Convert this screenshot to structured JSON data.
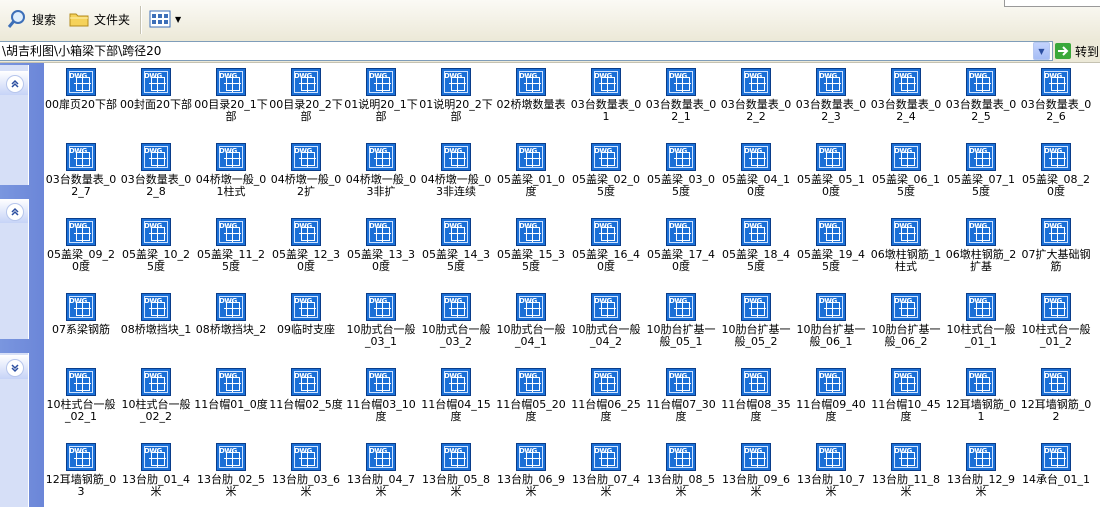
{
  "toolbar": {
    "search_label": "搜索",
    "folders_label": "文件夹",
    "view_label": ""
  },
  "address": {
    "path": "\\胡吉利图\\小箱梁下部\\跨径20",
    "go_label": "转到"
  },
  "files": [
    [
      "00扉页20下部",
      "00封面20下部",
      "00目录20_1下部",
      "00目录20_2下部",
      "01说明20_1下部",
      "01说明20_2下部",
      "02桥墩数量表",
      "03台数量表_01",
      "03台数量表_02_1",
      "03台数量表_02_2",
      "03台数量表_02_3",
      "03台数量表_02_4",
      "03台数量表_02_5",
      "03台数量表_02_6"
    ],
    [
      "03台数量表_02_7",
      "03台数量表_02_8",
      "04桥墩一般_01柱式",
      "04桥墩一般_02扩",
      "04桥墩一般_03非扩",
      "04桥墩一般_03非连续",
      "05盖梁_01_0度",
      "05盖梁_02_05度",
      "05盖梁_03_05度",
      "05盖梁_04_10度",
      "05盖梁_05_10度",
      "05盖梁_06_15度",
      "05盖梁_07_15度",
      "05盖梁_08_20度"
    ],
    [
      "05盖梁_09_20度",
      "05盖梁_10_25度",
      "05盖梁_11_25度",
      "05盖梁_12_30度",
      "05盖梁_13_30度",
      "05盖梁_14_35度",
      "05盖梁_15_35度",
      "05盖梁_16_40度",
      "05盖梁_17_40度",
      "05盖梁_18_45度",
      "05盖梁_19_45度",
      "06墩柱钢筋_1柱式",
      "06墩柱钢筋_2扩基",
      "07扩大基础钢筋"
    ],
    [
      "07系梁钢筋",
      "08桥墩挡块_1",
      "08桥墩挡块_2",
      "09临时支座",
      "10肋式台一般_03_1",
      "10肋式台一般_03_2",
      "10肋式台一般_04_1",
      "10肋式台一般_04_2",
      "10肋台扩基一般_05_1",
      "10肋台扩基一般_05_2",
      "10肋台扩基一般_06_1",
      "10肋台扩基一般_06_2",
      "10柱式台一般_01_1",
      "10柱式台一般_01_2"
    ],
    [
      "10柱式台一般_02_1",
      "10柱式台一般_02_2",
      "11台帽01_0度",
      "11台帽02_5度",
      "11台帽03_10度",
      "11台帽04_15度",
      "11台帽05_20度",
      "11台帽06_25度",
      "11台帽07_30度",
      "11台帽08_35度",
      "11台帽09_40度",
      "11台帽10_45度",
      "12耳墙钢筋_01",
      "12耳墙钢筋_02"
    ],
    [
      "12耳墙钢筋_03",
      "13台肋_01_4米",
      "13台肋_02_5米",
      "13台肋_03_6米",
      "13台肋_04_7米",
      "13台肋_05_8米",
      "13台肋_06_9米",
      "13台肋_07_4米",
      "13台肋_08_5米",
      "13台肋_09_6米",
      "13台肋_10_7米",
      "13台肋_11_8米",
      "13台肋_12_9米",
      "14承台_01_1"
    ]
  ],
  "icon_label": "DWG",
  "colors": {
    "taskpane": "#6b86d8",
    "dwg_blue": "#1a6fd6"
  }
}
